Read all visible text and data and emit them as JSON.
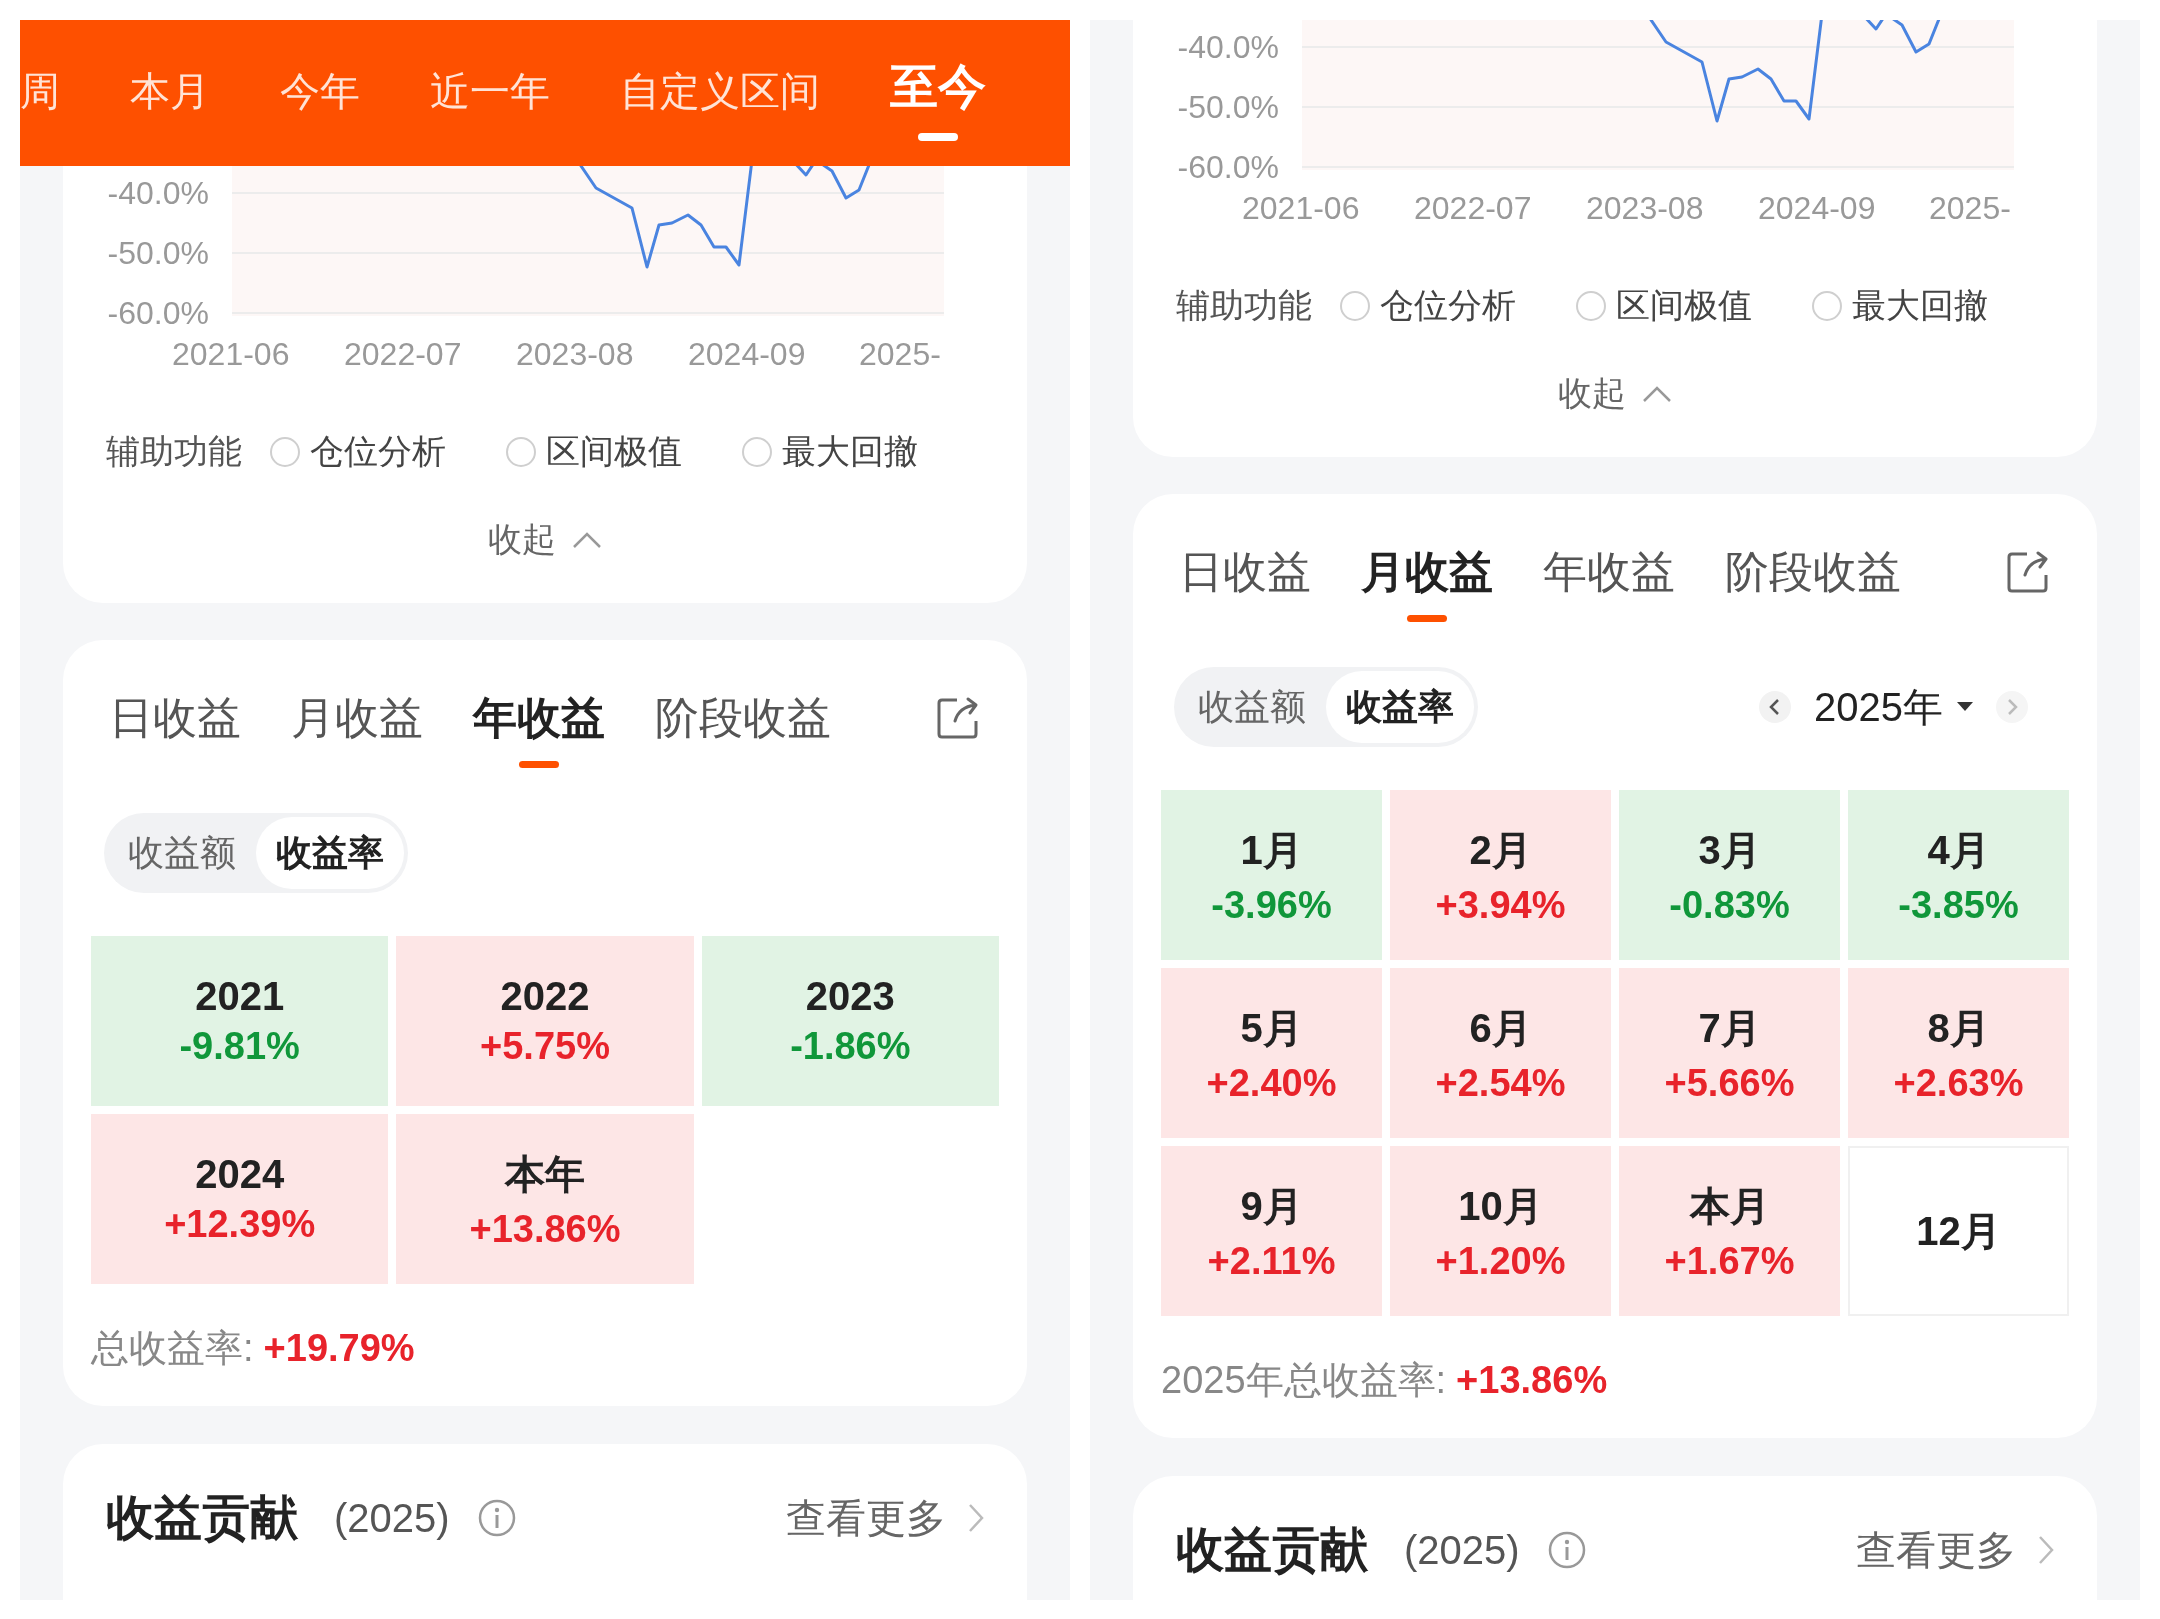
{
  "panels": [
    {
      "period_tabs": [
        {
          "label": "周",
          "selected": false
        },
        {
          "label": "本月",
          "selected": false
        },
        {
          "label": "今年",
          "selected": false
        },
        {
          "label": "近一年",
          "selected": false
        },
        {
          "label": "自定义区间",
          "selected": false
        },
        {
          "label": "至今",
          "selected": true
        }
      ],
      "chart": {
        "y_labels": [
          "-40.0%",
          "-50.0%",
          "-60.0%"
        ],
        "x_labels": [
          "2021-06",
          "2022-07",
          "2023-08",
          "2024-09",
          "2025-"
        ]
      },
      "aux": {
        "label": "辅助功能",
        "options": [
          {
            "label": "仓位分析",
            "checked": false
          },
          {
            "label": "区间极值",
            "checked": false
          },
          {
            "label": "最大回撤",
            "checked": false
          }
        ]
      },
      "collapse": "收起",
      "returns": {
        "tabs": [
          {
            "label": "日收益",
            "selected": false
          },
          {
            "label": "月收益",
            "selected": false
          },
          {
            "label": "年收益",
            "selected": true
          },
          {
            "label": "阶段收益",
            "selected": false
          }
        ],
        "toggle": [
          {
            "label": "收益额",
            "selected": false
          },
          {
            "label": "收益率",
            "selected": true
          }
        ],
        "cells": [
          {
            "label": "2021",
            "value": "-9.81%",
            "kind": "down"
          },
          {
            "label": "2022",
            "value": "+5.75%",
            "kind": "up"
          },
          {
            "label": "2023",
            "value": "-1.86%",
            "kind": "down"
          },
          {
            "label": "2024",
            "value": "+12.39%",
            "kind": "up"
          },
          {
            "label": "本年",
            "value": "+13.86%",
            "kind": "up"
          }
        ],
        "total_label": "总收益率:",
        "total_value": "+19.79%"
      },
      "contribution": {
        "title": "收益贡献",
        "year": "(2025)",
        "more": "查看更多"
      }
    },
    {
      "chart": {
        "y_labels": [
          "-40.0%",
          "-50.0%",
          "-60.0%"
        ],
        "x_labels": [
          "2021-06",
          "2022-07",
          "2023-08",
          "2024-09",
          "2025-"
        ]
      },
      "aux": {
        "label": "辅助功能",
        "options": [
          {
            "label": "仓位分析",
            "checked": false
          },
          {
            "label": "区间极值",
            "checked": false
          },
          {
            "label": "最大回撤",
            "checked": false
          }
        ]
      },
      "collapse": "收起",
      "returns": {
        "tabs": [
          {
            "label": "日收益",
            "selected": false
          },
          {
            "label": "月收益",
            "selected": true
          },
          {
            "label": "年收益",
            "selected": false
          },
          {
            "label": "阶段收益",
            "selected": false
          }
        ],
        "toggle": [
          {
            "label": "收益额",
            "selected": false
          },
          {
            "label": "收益率",
            "selected": true
          }
        ],
        "period": "2025年",
        "cells": [
          {
            "label": "1月",
            "value": "-3.96%",
            "kind": "down"
          },
          {
            "label": "2月",
            "value": "+3.94%",
            "kind": "up"
          },
          {
            "label": "3月",
            "value": "-0.83%",
            "kind": "down"
          },
          {
            "label": "4月",
            "value": "-3.85%",
            "kind": "down"
          },
          {
            "label": "5月",
            "value": "+2.40%",
            "kind": "up"
          },
          {
            "label": "6月",
            "value": "+2.54%",
            "kind": "up"
          },
          {
            "label": "7月",
            "value": "+5.66%",
            "kind": "up"
          },
          {
            "label": "8月",
            "value": "+2.63%",
            "kind": "up"
          },
          {
            "label": "9月",
            "value": "+2.11%",
            "kind": "up"
          },
          {
            "label": "10月",
            "value": "+1.20%",
            "kind": "up"
          },
          {
            "label": "本月",
            "value": "+1.67%",
            "kind": "up"
          },
          {
            "label": "12月",
            "kind": "none"
          }
        ],
        "total_label": "2025年总收益率:",
        "total_value": "+13.86%"
      },
      "contribution": {
        "title": "收益贡献",
        "year": "(2025)",
        "more": "查看更多"
      }
    }
  ]
}
